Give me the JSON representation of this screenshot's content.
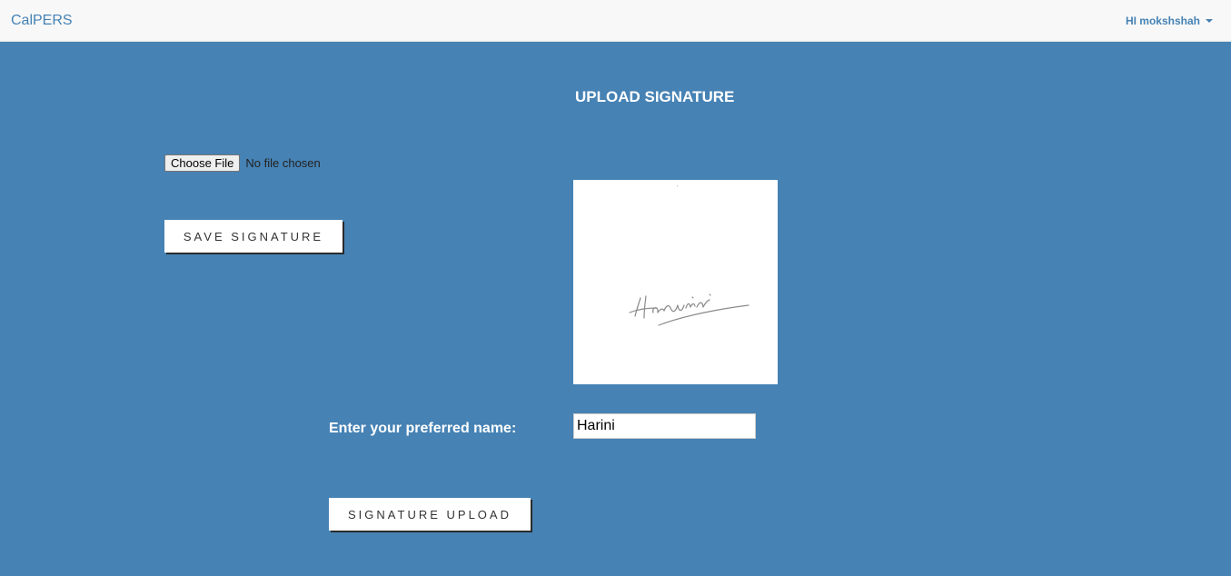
{
  "navbar": {
    "brand": "CalPERS",
    "user_greeting": "HI mokshshah"
  },
  "main": {
    "title": "UPLOAD SIGNATURE",
    "file_input": {
      "button_label": "Choose File",
      "status": "No file chosen"
    },
    "save_button": "SAVE SIGNATURE",
    "signature_image": {
      "handwritten_text": "Harini"
    },
    "name_label": "Enter your preferred name:",
    "name_value": "Harini",
    "upload_button": "SIGNATURE UPLOAD"
  },
  "colors": {
    "background": "#4682b4",
    "navbar": "#f8f8f8",
    "accent": "#4682b4"
  }
}
